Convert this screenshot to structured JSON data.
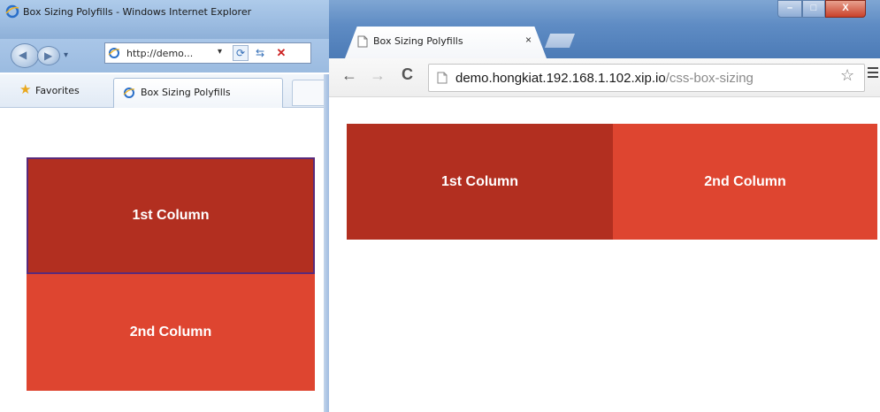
{
  "ie_window": {
    "title": "Box Sizing Polyfills - Windows Internet Explorer",
    "address": "http://demo...",
    "favorites_label": "Favorites",
    "tab_label": "Box Sizing Polyfills",
    "columns": [
      {
        "label": "1st Column",
        "color": "#b22f20"
      },
      {
        "label": "2nd Column",
        "color": "#de4530"
      }
    ]
  },
  "chrome_window": {
    "tab_label": "Box Sizing Polyfills",
    "tab_close": "×",
    "url_host": "demo.hongkiat.192.168.1.102.xip.io",
    "url_path": "/css-box-sizing",
    "window_buttons": {
      "minimize": "–",
      "maximize": "□",
      "close": "X"
    },
    "columns": [
      {
        "label": "1st Column",
        "color": "#b22f20"
      },
      {
        "label": "2nd Column",
        "color": "#de4530"
      }
    ]
  },
  "icons": [
    "ie-logo-icon",
    "back-icon",
    "forward-icon",
    "refresh-icon",
    "stop-icon",
    "star-icon",
    "page-icon",
    "menu-icon"
  ]
}
